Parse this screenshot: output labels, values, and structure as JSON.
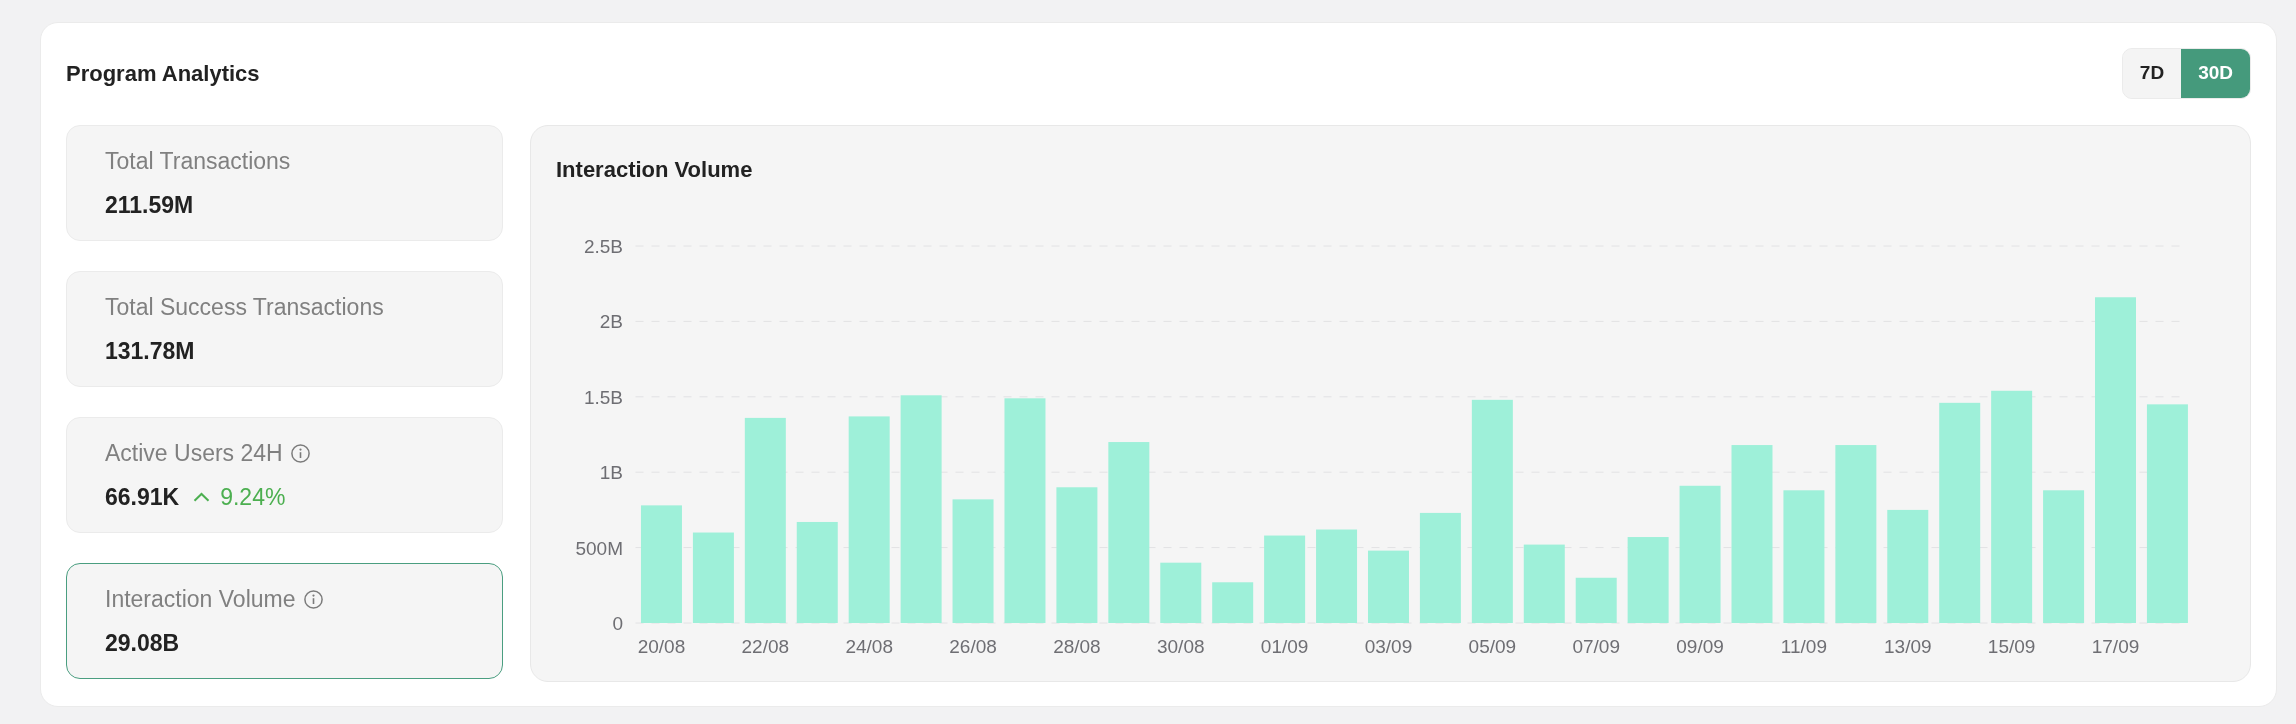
{
  "title": "Program Analytics",
  "range_tabs": [
    {
      "label": "7D",
      "selected": false
    },
    {
      "label": "30D",
      "selected": true
    }
  ],
  "stats": [
    {
      "label": "Total Transactions",
      "info": false,
      "value": "211.59M",
      "selected": false
    },
    {
      "label": "Total Success Transactions",
      "info": false,
      "value": "131.78M",
      "selected": false
    },
    {
      "label": "Active Users 24H",
      "info": true,
      "value": "66.91K",
      "change": {
        "rising": true,
        "text": "9.24%"
      },
      "selected": false
    },
    {
      "label": "Interaction Volume",
      "info": true,
      "value": "29.08B",
      "selected": true
    }
  ],
  "chart_panel": {
    "title": "Interaction Volume",
    "chart_data": {
      "type": "bar",
      "grid": true,
      "categories": [
        "20/08",
        null,
        "22/08",
        null,
        "24/08",
        null,
        "26/08",
        null,
        "28/08",
        null,
        "30/08",
        null,
        "01/09",
        null,
        "03/09",
        null,
        "05/09",
        null,
        "07/09",
        null,
        "09/09",
        null,
        "11/09",
        null,
        "13/09",
        null,
        "15/09",
        null,
        "17/09",
        null
      ],
      "series": [
        {
          "color": "#9ef0d9",
          "values": [
            780000000,
            600000000,
            1360000000,
            670000000,
            1370000000,
            1510000000,
            820000000,
            1490000000,
            900000000,
            1200000000,
            400000000,
            270000000,
            580000000,
            620000000,
            480000000,
            730000000,
            1480000000,
            520000000,
            300000000,
            570000000,
            910000000,
            1180000000,
            880000000,
            1180000000,
            750000000,
            1460000000,
            1540000000,
            880000000,
            2160000000,
            1450000000
          ]
        }
      ],
      "ylim": [
        0,
        2500000000
      ],
      "yticks": [
        {
          "value": 0,
          "label": "0"
        },
        {
          "value": 500000000,
          "label": "500M"
        },
        {
          "value": 1000000000,
          "label": "1B"
        },
        {
          "value": 1500000000,
          "label": "1.5B"
        },
        {
          "value": 2000000000,
          "label": "2B"
        },
        {
          "value": 2500000000,
          "label": "2.5B"
        }
      ]
    }
  }
}
